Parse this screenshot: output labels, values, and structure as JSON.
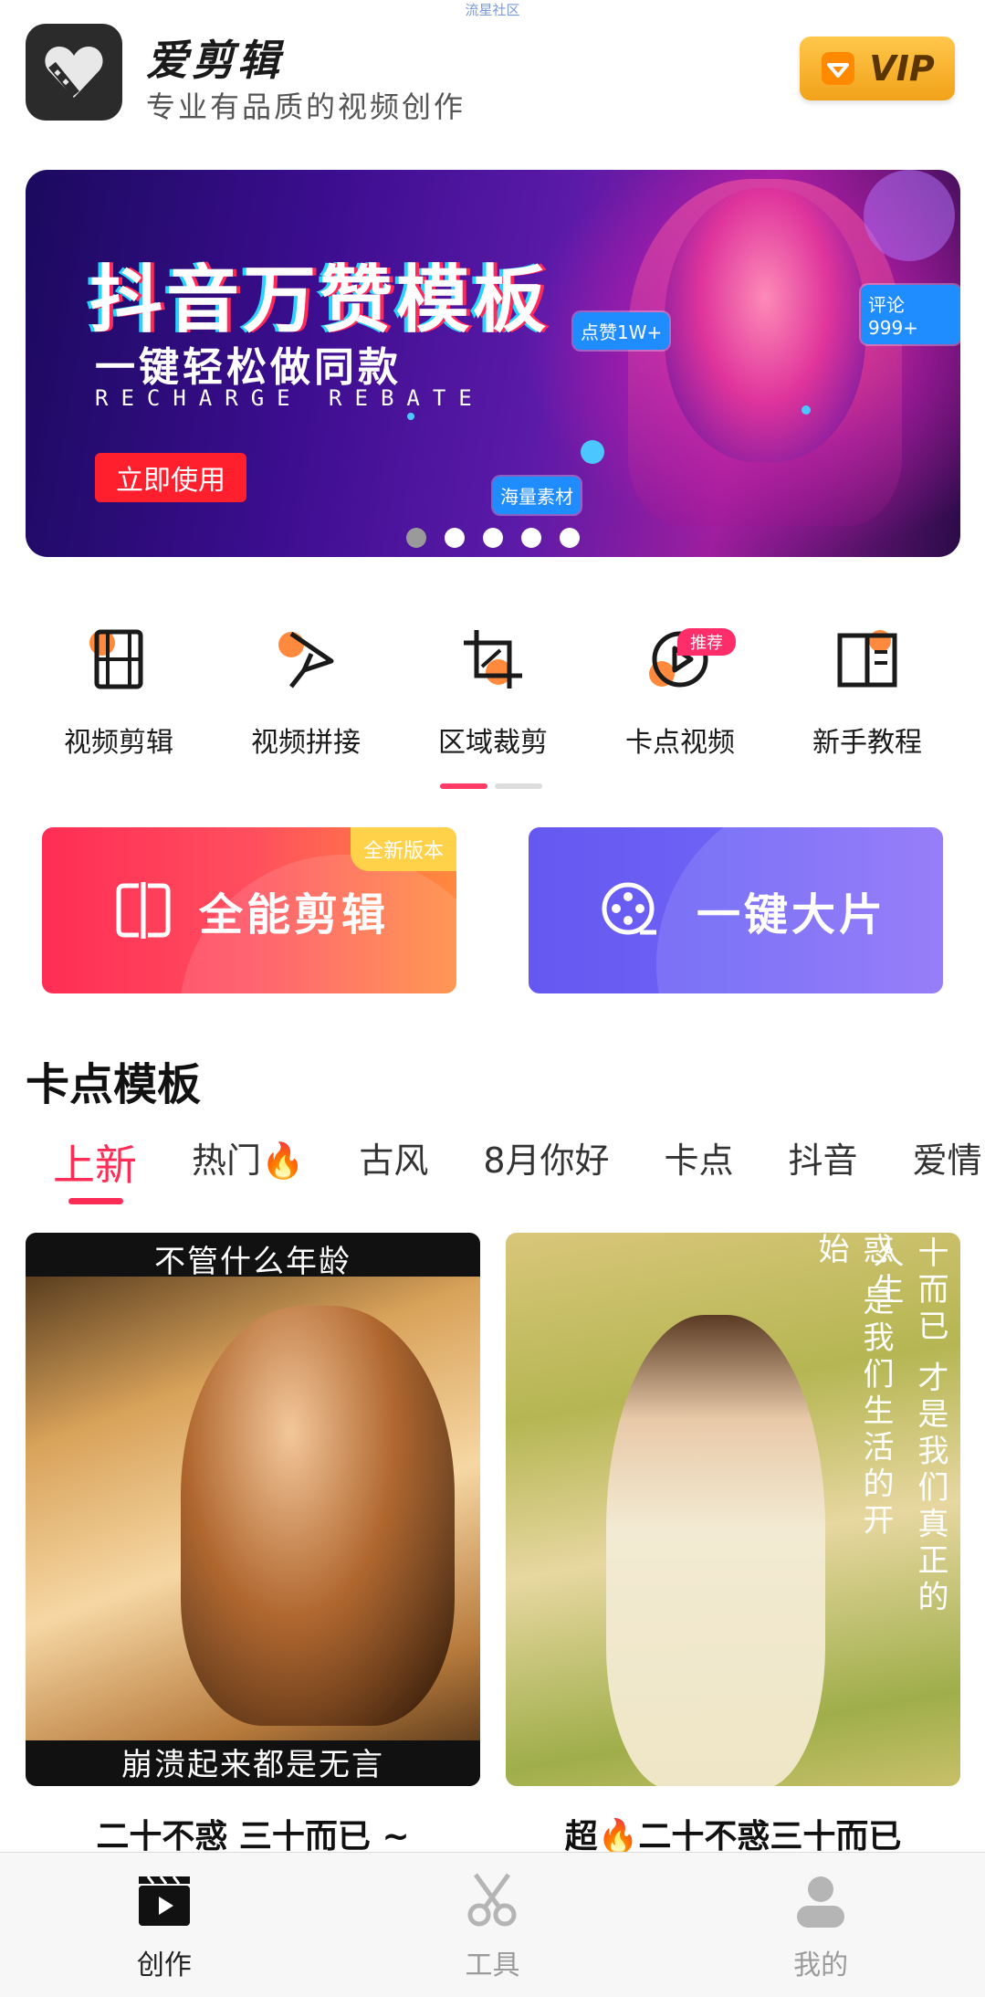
{
  "watermark": "流星社区",
  "header": {
    "app_name": "爱剪辑",
    "slogan": "专业有品质的视频创作",
    "vip_label": "VIP"
  },
  "banner": {
    "title": "抖音万赞模板",
    "subtitle": "一键轻松做同款",
    "english": "RECHARGE REBATE",
    "cta": "立即使用",
    "tag_likes": "点赞1W+",
    "tag_comments": "评论999+",
    "tag_material": "海量素材",
    "slide_count": 5,
    "active_slide": 1
  },
  "features": [
    {
      "label": "视频剪辑",
      "icon": "film-strip-icon"
    },
    {
      "label": "视频拼接",
      "icon": "splice-icon"
    },
    {
      "label": "区域裁剪",
      "icon": "crop-icon"
    },
    {
      "label": "卡点视频",
      "icon": "beat-play-icon",
      "badge": "推荐"
    },
    {
      "label": "新手教程",
      "icon": "tutorial-book-icon"
    }
  ],
  "actions": {
    "all_edit": {
      "label": "全能剪辑",
      "badge": "全新版本"
    },
    "one_click": {
      "label": "一键大片"
    }
  },
  "templates": {
    "section_title": "卡点模板",
    "tabs": [
      "上新",
      "热门🔥",
      "古风",
      "8月你好",
      "卡点",
      "抖音",
      "爱情"
    ],
    "active_tab": "上新",
    "items": [
      {
        "title": "二十不惑 三十而已 ~",
        "caption_top": "不管什么年龄",
        "caption_bottom": "崩溃起来都是无言"
      },
      {
        "title": "超🔥二十不惑三十而已",
        "vertical_right": "十而已 才是我们真正的人生",
        "vertical_left": "惑 是我们生活的开始"
      }
    ]
  },
  "bottom_nav": [
    {
      "label": "创作",
      "icon": "clapper-play-icon",
      "active": true
    },
    {
      "label": "工具",
      "icon": "scissors-icon",
      "active": false
    },
    {
      "label": "我的",
      "icon": "user-icon",
      "active": false
    }
  ],
  "colors": {
    "accent": "#ff2d55",
    "vip_gold": "#f2a21a",
    "card_blue": "#6558f0"
  }
}
